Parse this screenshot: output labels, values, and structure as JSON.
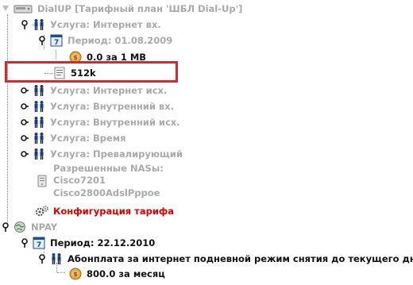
{
  "tree": {
    "dialup": {
      "label": "DialUP [Тарифный план 'ШБЛ Dial-Up']"
    },
    "service_inet_in": {
      "label": "Услуга: Интернет вх."
    },
    "period_1": {
      "label": "Период: 01.08.2009"
    },
    "price_1": {
      "label": "0.0 за 1 MB"
    },
    "item_512k": {
      "label": "512k"
    },
    "service_inet_out": {
      "label": "Услуга: Интернет исх."
    },
    "service_int_in": {
      "label": "Услуга: Внутренний вх."
    },
    "service_int_out": {
      "label": "Услуга: Внутренний исх."
    },
    "service_time": {
      "label": "Услуга: Время"
    },
    "service_prevailing": {
      "label": "Услуга: Превалирующий"
    },
    "nas": {
      "lines": [
        "Разрешенные NASы:",
        "Cisco7201",
        "Cisco2800AdslPppoe"
      ]
    },
    "config": {
      "label": "Конфигурация тарифа"
    },
    "npay": {
      "label": "NPAY"
    },
    "period_2": {
      "label": "Период: 22.12.2010"
    },
    "subscription": {
      "label": "Абонплата за интернет подневной режим снятия до текущего дня"
    },
    "price_2": {
      "label": "800.0 за месяц"
    }
  },
  "colors": {
    "highlight": "#d9262b",
    "red_text": "#e00000",
    "gray_text": "#a9a9a9"
  }
}
